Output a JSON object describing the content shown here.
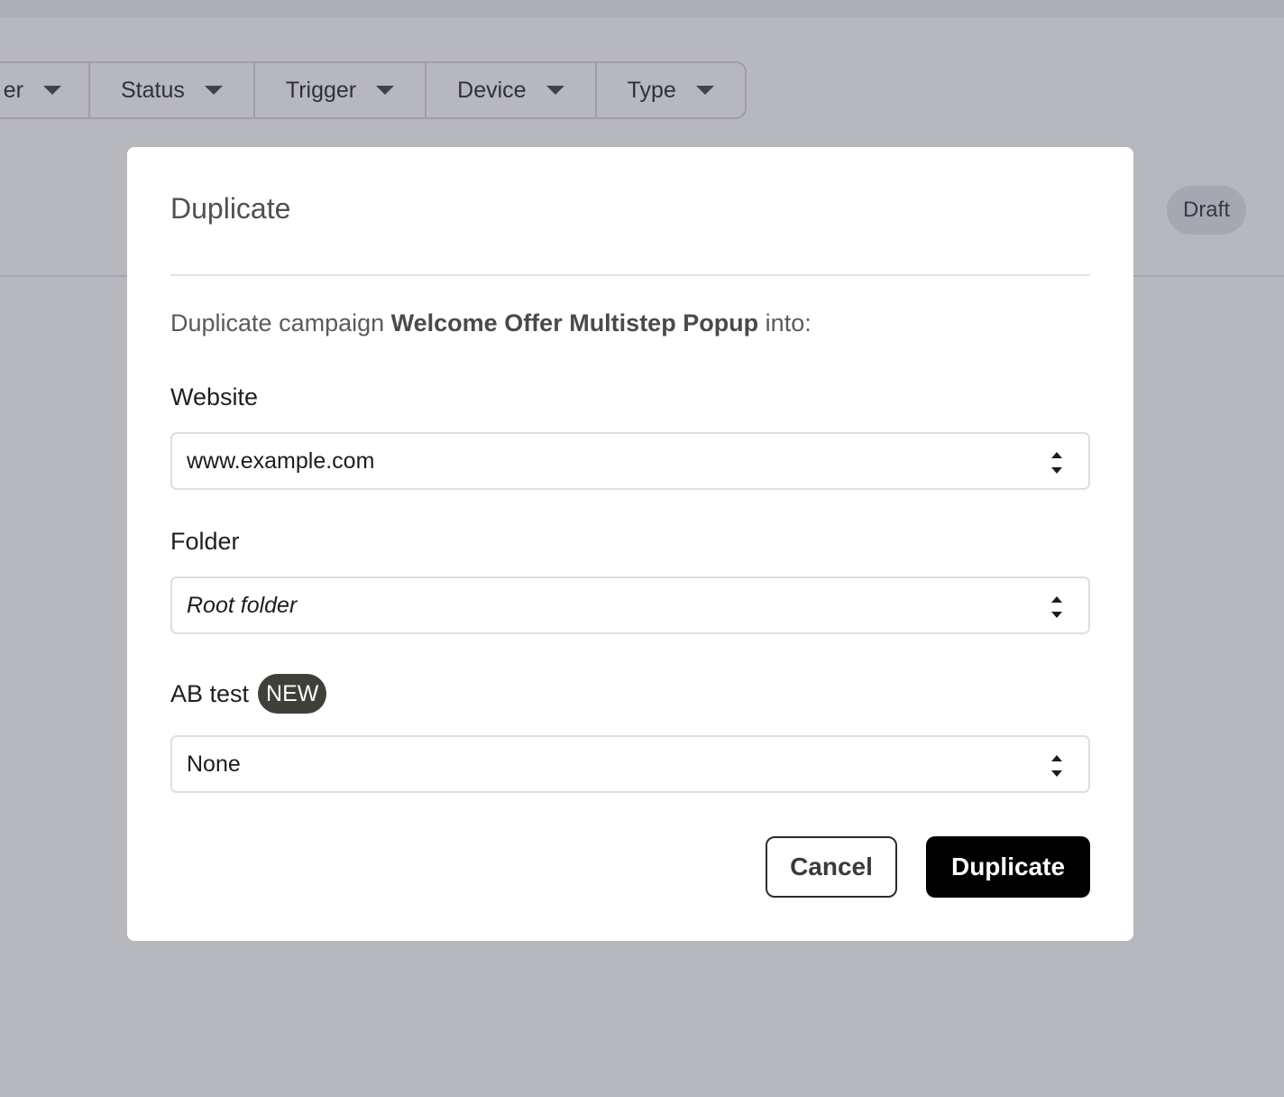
{
  "background": {
    "filters": [
      {
        "label": "er"
      },
      {
        "label": "Status"
      },
      {
        "label": "Trigger"
      },
      {
        "label": "Device"
      },
      {
        "label": "Type"
      }
    ],
    "status_badge": "Draft"
  },
  "modal": {
    "title": "Duplicate",
    "description_prefix": "Duplicate campaign ",
    "campaign_name": "Welcome Offer Multistep Popup",
    "description_suffix": " into:",
    "website": {
      "label": "Website",
      "value": "www.example.com"
    },
    "folder": {
      "label": "Folder",
      "value": "Root folder"
    },
    "ab_test": {
      "label": "AB test",
      "badge": "NEW",
      "value": "None"
    },
    "cancel_label": "Cancel",
    "confirm_label": "Duplicate"
  }
}
